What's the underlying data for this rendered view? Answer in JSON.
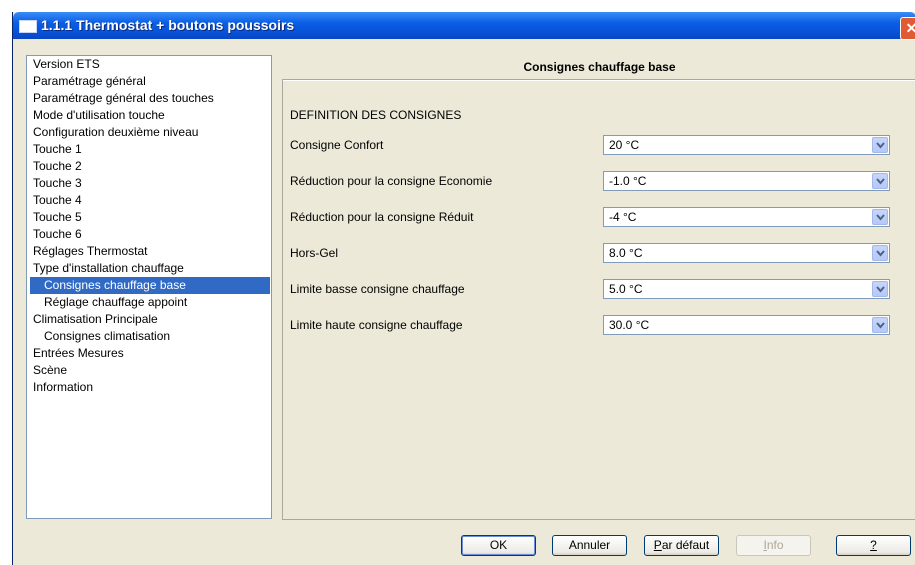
{
  "window": {
    "title": "1.1.1 Thermostat + boutons poussoirs",
    "close_glyph": "✕"
  },
  "tree": {
    "items": [
      {
        "label": "Version ETS",
        "level": 1
      },
      {
        "label": "Paramétrage général",
        "level": 1
      },
      {
        "label": "Paramétrage général des touches",
        "level": 1
      },
      {
        "label": "Mode d'utilisation touche",
        "level": 1
      },
      {
        "label": "Configuration deuxième niveau",
        "level": 1
      },
      {
        "label": "Touche 1",
        "level": 1
      },
      {
        "label": "Touche 2",
        "level": 1
      },
      {
        "label": "Touche 3",
        "level": 1
      },
      {
        "label": "Touche 4",
        "level": 1
      },
      {
        "label": "Touche 5",
        "level": 1
      },
      {
        "label": "Touche 6",
        "level": 1
      },
      {
        "label": "Réglages Thermostat",
        "level": 1
      },
      {
        "label": "Type d'installation chauffage",
        "level": 1
      },
      {
        "label": "Consignes chauffage base",
        "level": 2,
        "selected": true
      },
      {
        "label": "Réglage chauffage appoint",
        "level": 2
      },
      {
        "label": "Climatisation Principale",
        "level": 1
      },
      {
        "label": "Consignes climatisation",
        "level": 2
      },
      {
        "label": "Entrées Mesures",
        "level": 1
      },
      {
        "label": "Scène",
        "level": 1
      },
      {
        "label": "Information",
        "level": 1
      }
    ]
  },
  "panel": {
    "title": "Consignes chauffage base",
    "section_title": "DEFINITION DES CONSIGNES",
    "fields": [
      {
        "label": "Consigne Confort",
        "value": "20 °C"
      },
      {
        "label": "Réduction pour la consigne Economie",
        "value": "-1.0 °C"
      },
      {
        "label": "Réduction pour la consigne Réduit",
        "value": "-4 °C"
      },
      {
        "label": "Hors-Gel",
        "value": "8.0 °C"
      },
      {
        "label": "Limite basse consigne chauffage",
        "value": "5.0 °C"
      },
      {
        "label": "Limite haute consigne chauffage",
        "value": "30.0 °C"
      }
    ]
  },
  "buttons": {
    "ok": "OK",
    "cancel": "Annuler",
    "default_first": "P",
    "default_rest": "ar défaut",
    "info_first": "I",
    "info_rest": "nfo",
    "help": "?"
  },
  "colors": {
    "selection": "#316ac5",
    "titlebar": "#0a5fe6",
    "dialog_bg": "#ece9d8"
  }
}
